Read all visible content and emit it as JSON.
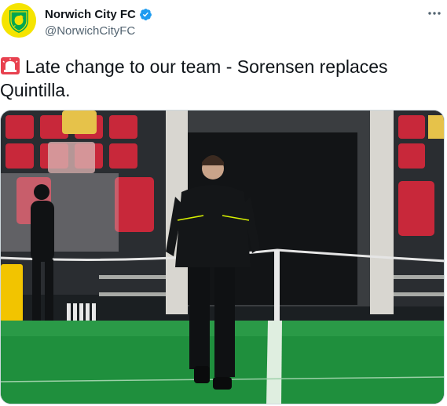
{
  "account": {
    "name": "Norwich City FC",
    "handle": "@NorwichCityFC"
  },
  "icons": {
    "verified": "verified-badge-icon",
    "more": "more-options-icon",
    "emoji": "rotating-light-icon"
  },
  "tweet": {
    "line1": "Late change to our team - Sorensen replaces",
    "line2": "Quintilla."
  },
  "media": {
    "description_hidden": ""
  },
  "colors": {
    "verified_blue": "#1d9bf0",
    "handle_gray": "#536471",
    "norwich_yellow": "#f5e400",
    "norwich_green": "#00a650"
  }
}
